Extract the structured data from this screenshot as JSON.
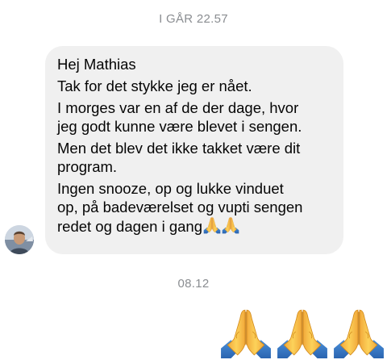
{
  "thread": {
    "timestamp_1": "I GÅR 22.57",
    "timestamp_2": "08.12"
  },
  "incoming_message": {
    "paragraphs": [
      [
        "Hej Mathias"
      ],
      [
        "Tak for det stykke jeg er nået."
      ],
      [
        "I morges var en af de der dage, hvor",
        "jeg godt kunne være blevet i sengen."
      ],
      [
        "Men det blev det ikke takket være dit",
        "program."
      ],
      [
        "Ingen snooze, op og lukke vinduet",
        "op, på badeværelset og vupti sengen",
        "redet og dagen i gang"
      ]
    ],
    "trailing_emoji": [
      "folded-hands",
      "folded-hands"
    ]
  },
  "outgoing_message": {
    "emoji": [
      "folded-hands",
      "folded-hands",
      "folded-hands"
    ]
  },
  "colors": {
    "incoming_bubble": "#f0f0f0",
    "timestamp": "#8a8d91",
    "text": "#050505"
  }
}
